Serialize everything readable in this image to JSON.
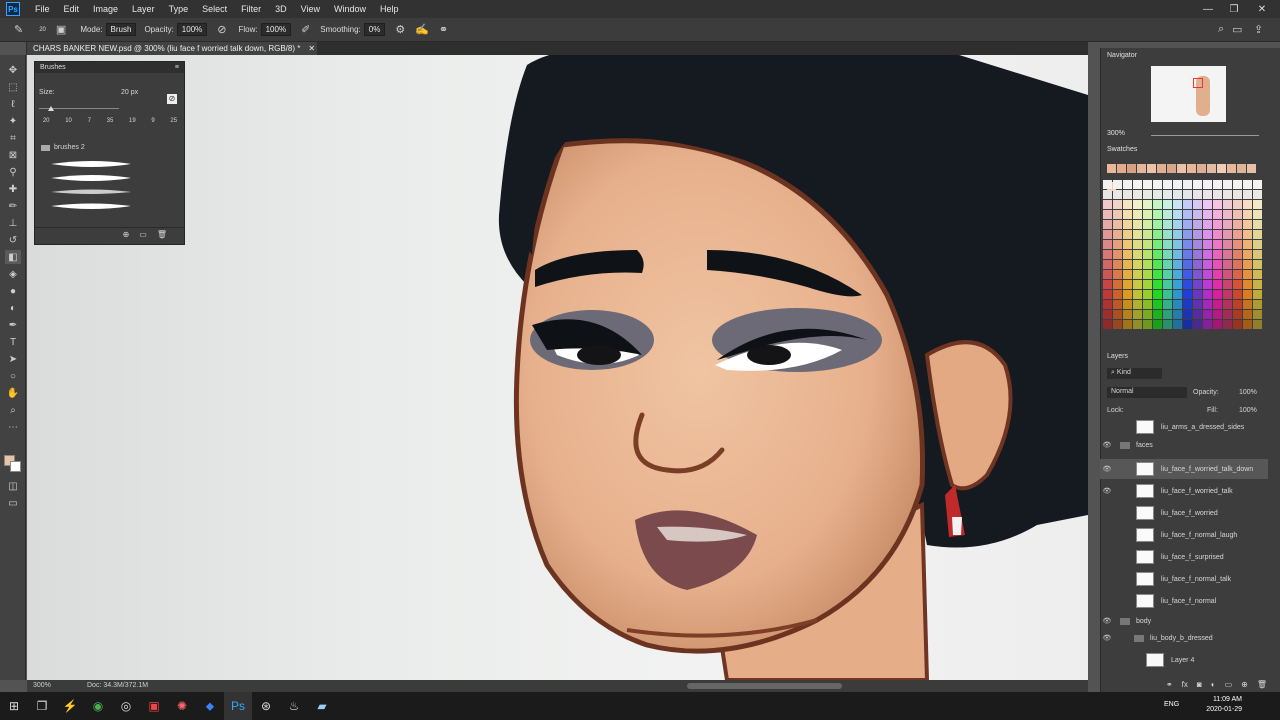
{
  "app": {
    "logo": "Ps",
    "menu": [
      "File",
      "Edit",
      "Image",
      "Layer",
      "Type",
      "Select",
      "Filter",
      "3D",
      "View",
      "Window",
      "Help"
    ]
  },
  "window_controls": [
    "—",
    "❐",
    "✕"
  ],
  "options": {
    "brush_size_small": "20",
    "mode_label": "Mode:",
    "mode_value": "Brush",
    "opacity_label": "Opacity:",
    "opacity_value": "100%",
    "flow_label": "Flow:",
    "flow_value": "100%",
    "smoothing_label": "Smoothing:",
    "smoothing_value": "0%"
  },
  "document": {
    "tab_title": "CHARS BANKER NEW.psd @ 300% (liu face f worried talk down, RGB/8) *"
  },
  "brushes_panel": {
    "title": "Brushes",
    "size_label": "Size:",
    "size_value": "20 px",
    "presets": [
      "20",
      "10",
      "7",
      "35",
      "19",
      "9",
      "25"
    ],
    "folder_name": "brushes 2"
  },
  "status": {
    "zoom": "300%",
    "doc": "Doc: 34.3M/372.1M"
  },
  "navigator": {
    "title": "Navigator",
    "zoom": "300%"
  },
  "swatches": {
    "title": "Swatches"
  },
  "layers": {
    "title": "Layers",
    "filter": "Kind",
    "blend": "Normal",
    "opacity_label": "Opacity:",
    "opacity_value": "100%",
    "lock_label": "Lock:",
    "fill_label": "Fill:",
    "fill_value": "100%",
    "rows": [
      {
        "name": "liu_arms_a_dressed_sides",
        "type": "layer",
        "visible": false
      },
      {
        "name": "faces",
        "type": "group",
        "visible": true
      },
      {
        "name": "liu_face_f_worried_talk_down",
        "type": "layer",
        "visible": true,
        "selected": true
      },
      {
        "name": "liu_face_f_worried_talk",
        "type": "layer",
        "visible": true
      },
      {
        "name": "liu_face_f_worried",
        "type": "layer",
        "visible": false
      },
      {
        "name": "liu_face_f_normal_laugh",
        "type": "layer",
        "visible": false
      },
      {
        "name": "liu_face_f_surprised",
        "type": "layer",
        "visible": false
      },
      {
        "name": "liu_face_f_normal_talk",
        "type": "layer",
        "visible": false
      },
      {
        "name": "liu_face_f_normal",
        "type": "layer",
        "visible": false
      },
      {
        "name": "body",
        "type": "group",
        "visible": true
      },
      {
        "name": "liu_body_b_dressed",
        "type": "group",
        "visible": true
      },
      {
        "name": "Layer 4",
        "type": "layer",
        "visible": false
      }
    ]
  },
  "taskbar": {
    "lang": "ENG",
    "time": "11:09 AM",
    "date": "2020-01-29"
  },
  "colors": {
    "accent": "#31a8ff",
    "foreground": "#e9c3a8",
    "background": "#ffffff"
  }
}
